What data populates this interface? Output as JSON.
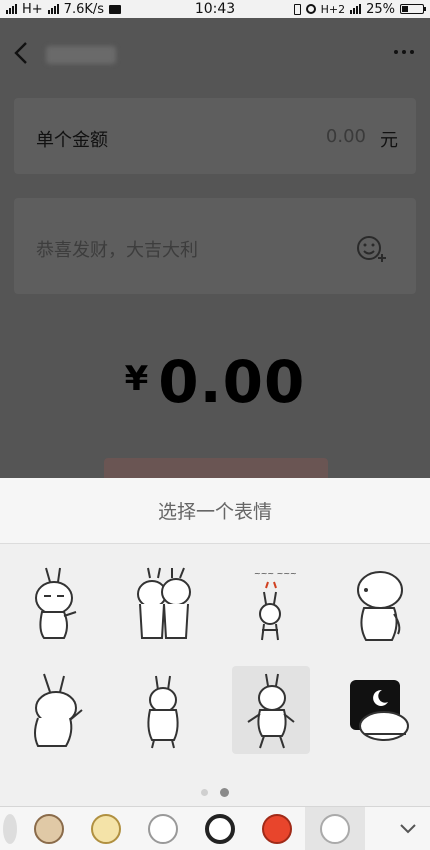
{
  "status_bar": {
    "network_left": "H+",
    "speed": "7.6K/s",
    "time": "10:43",
    "network_right": "H+2",
    "battery": "25%"
  },
  "background_page": {
    "single_amount_label": "单个金额",
    "amount_value": "0.00",
    "amount_unit": "元",
    "greeting_placeholder": "恭喜发财，大吉大利",
    "total_currency": "¥",
    "total_amount": "0.00"
  },
  "sticker_sheet": {
    "title": "选择一个表情",
    "stickers": [
      {
        "name": "rabbit-thinking"
      },
      {
        "name": "rabbits-hugging"
      },
      {
        "name": "rabbit-birthday"
      },
      {
        "name": "rabbit-turning"
      },
      {
        "name": "rabbit-waving"
      },
      {
        "name": "rabbit-standing-back"
      },
      {
        "name": "rabbit-dancing"
      },
      {
        "name": "rabbit-sleeping-night"
      }
    ],
    "selected_index": 6,
    "page_count": 2,
    "current_page": 1
  },
  "sticker_tabs": {
    "items": [
      "sticker-pack-1",
      "sticker-pack-2",
      "sticker-pack-3",
      "sticker-pack-4",
      "sticker-pack-5",
      "sticker-pack-6",
      "sticker-pack-7"
    ],
    "selected_index": 6,
    "expand_icon": "chevron-down-icon"
  }
}
